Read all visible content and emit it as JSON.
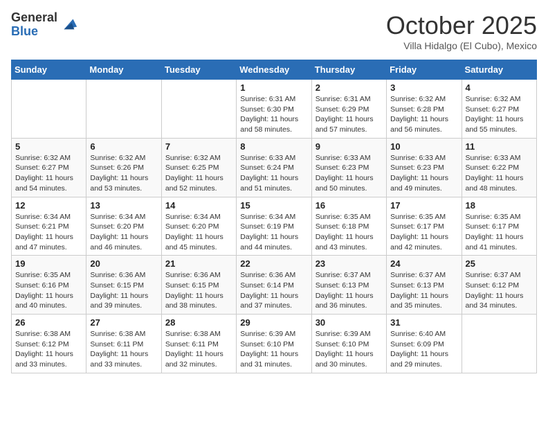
{
  "logo": {
    "general": "General",
    "blue": "Blue"
  },
  "title": "October 2025",
  "subtitle": "Villa Hidalgo (El Cubo), Mexico",
  "days_header": [
    "Sunday",
    "Monday",
    "Tuesday",
    "Wednesday",
    "Thursday",
    "Friday",
    "Saturday"
  ],
  "weeks": [
    [
      {
        "day": "",
        "info": ""
      },
      {
        "day": "",
        "info": ""
      },
      {
        "day": "",
        "info": ""
      },
      {
        "day": "1",
        "info": "Sunrise: 6:31 AM\nSunset: 6:30 PM\nDaylight: 11 hours and 58 minutes."
      },
      {
        "day": "2",
        "info": "Sunrise: 6:31 AM\nSunset: 6:29 PM\nDaylight: 11 hours and 57 minutes."
      },
      {
        "day": "3",
        "info": "Sunrise: 6:32 AM\nSunset: 6:28 PM\nDaylight: 11 hours and 56 minutes."
      },
      {
        "day": "4",
        "info": "Sunrise: 6:32 AM\nSunset: 6:27 PM\nDaylight: 11 hours and 55 minutes."
      }
    ],
    [
      {
        "day": "5",
        "info": "Sunrise: 6:32 AM\nSunset: 6:27 PM\nDaylight: 11 hours and 54 minutes."
      },
      {
        "day": "6",
        "info": "Sunrise: 6:32 AM\nSunset: 6:26 PM\nDaylight: 11 hours and 53 minutes."
      },
      {
        "day": "7",
        "info": "Sunrise: 6:32 AM\nSunset: 6:25 PM\nDaylight: 11 hours and 52 minutes."
      },
      {
        "day": "8",
        "info": "Sunrise: 6:33 AM\nSunset: 6:24 PM\nDaylight: 11 hours and 51 minutes."
      },
      {
        "day": "9",
        "info": "Sunrise: 6:33 AM\nSunset: 6:23 PM\nDaylight: 11 hours and 50 minutes."
      },
      {
        "day": "10",
        "info": "Sunrise: 6:33 AM\nSunset: 6:23 PM\nDaylight: 11 hours and 49 minutes."
      },
      {
        "day": "11",
        "info": "Sunrise: 6:33 AM\nSunset: 6:22 PM\nDaylight: 11 hours and 48 minutes."
      }
    ],
    [
      {
        "day": "12",
        "info": "Sunrise: 6:34 AM\nSunset: 6:21 PM\nDaylight: 11 hours and 47 minutes."
      },
      {
        "day": "13",
        "info": "Sunrise: 6:34 AM\nSunset: 6:20 PM\nDaylight: 11 hours and 46 minutes."
      },
      {
        "day": "14",
        "info": "Sunrise: 6:34 AM\nSunset: 6:20 PM\nDaylight: 11 hours and 45 minutes."
      },
      {
        "day": "15",
        "info": "Sunrise: 6:34 AM\nSunset: 6:19 PM\nDaylight: 11 hours and 44 minutes."
      },
      {
        "day": "16",
        "info": "Sunrise: 6:35 AM\nSunset: 6:18 PM\nDaylight: 11 hours and 43 minutes."
      },
      {
        "day": "17",
        "info": "Sunrise: 6:35 AM\nSunset: 6:17 PM\nDaylight: 11 hours and 42 minutes."
      },
      {
        "day": "18",
        "info": "Sunrise: 6:35 AM\nSunset: 6:17 PM\nDaylight: 11 hours and 41 minutes."
      }
    ],
    [
      {
        "day": "19",
        "info": "Sunrise: 6:35 AM\nSunset: 6:16 PM\nDaylight: 11 hours and 40 minutes."
      },
      {
        "day": "20",
        "info": "Sunrise: 6:36 AM\nSunset: 6:15 PM\nDaylight: 11 hours and 39 minutes."
      },
      {
        "day": "21",
        "info": "Sunrise: 6:36 AM\nSunset: 6:15 PM\nDaylight: 11 hours and 38 minutes."
      },
      {
        "day": "22",
        "info": "Sunrise: 6:36 AM\nSunset: 6:14 PM\nDaylight: 11 hours and 37 minutes."
      },
      {
        "day": "23",
        "info": "Sunrise: 6:37 AM\nSunset: 6:13 PM\nDaylight: 11 hours and 36 minutes."
      },
      {
        "day": "24",
        "info": "Sunrise: 6:37 AM\nSunset: 6:13 PM\nDaylight: 11 hours and 35 minutes."
      },
      {
        "day": "25",
        "info": "Sunrise: 6:37 AM\nSunset: 6:12 PM\nDaylight: 11 hours and 34 minutes."
      }
    ],
    [
      {
        "day": "26",
        "info": "Sunrise: 6:38 AM\nSunset: 6:12 PM\nDaylight: 11 hours and 33 minutes."
      },
      {
        "day": "27",
        "info": "Sunrise: 6:38 AM\nSunset: 6:11 PM\nDaylight: 11 hours and 33 minutes."
      },
      {
        "day": "28",
        "info": "Sunrise: 6:38 AM\nSunset: 6:11 PM\nDaylight: 11 hours and 32 minutes."
      },
      {
        "day": "29",
        "info": "Sunrise: 6:39 AM\nSunset: 6:10 PM\nDaylight: 11 hours and 31 minutes."
      },
      {
        "day": "30",
        "info": "Sunrise: 6:39 AM\nSunset: 6:10 PM\nDaylight: 11 hours and 30 minutes."
      },
      {
        "day": "31",
        "info": "Sunrise: 6:40 AM\nSunset: 6:09 PM\nDaylight: 11 hours and 29 minutes."
      },
      {
        "day": "",
        "info": ""
      }
    ]
  ]
}
